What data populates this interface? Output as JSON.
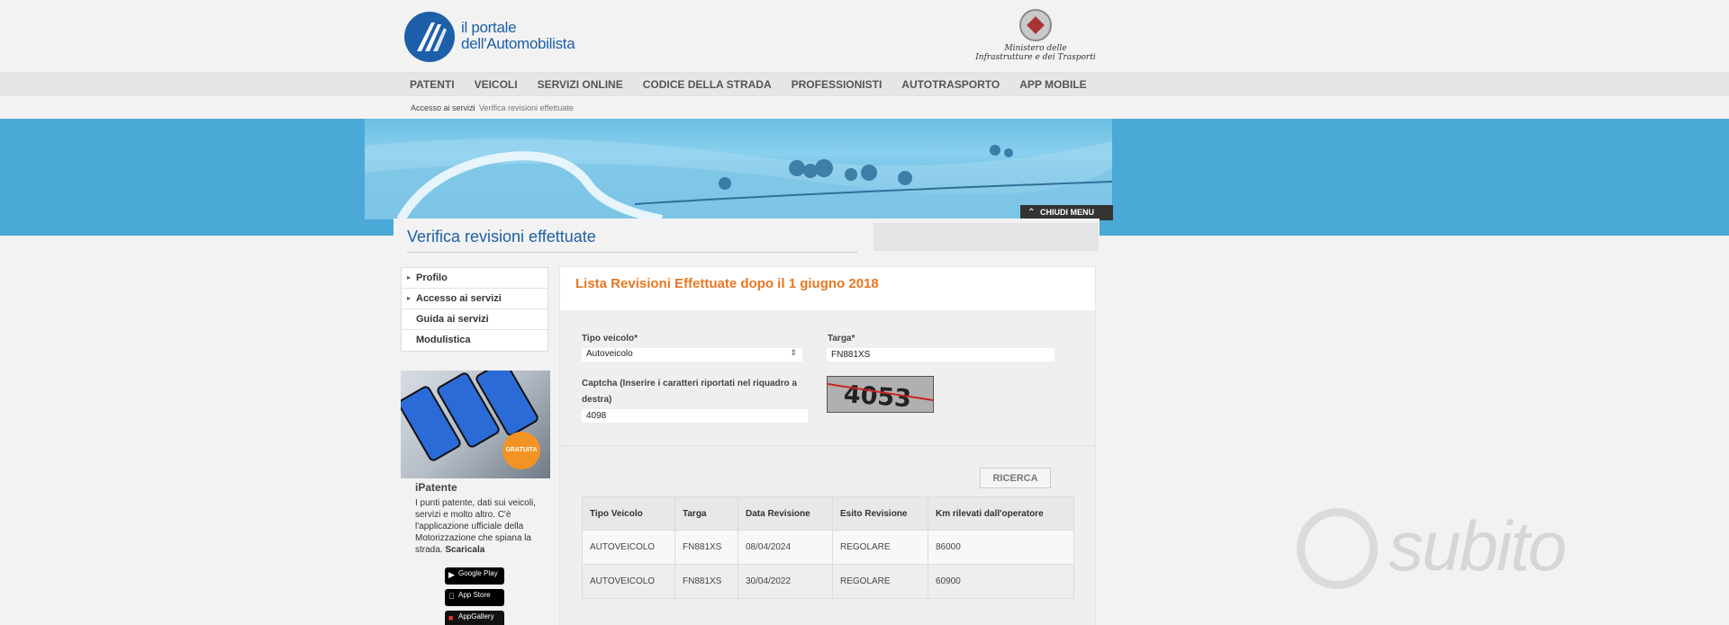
{
  "header": {
    "logo_line1": "il portale",
    "logo_line2": "dell'Automobilista",
    "ministry_line1": "Ministero delle",
    "ministry_line2": "Infrastrutture e dei Trasporti"
  },
  "nav": {
    "items": [
      "PATENTI",
      "VEICOLI",
      "SERVIZI ONLINE",
      "CODICE DELLA STRADA",
      "PROFESSIONISTI",
      "AUTOTRASPORTO",
      "APP MOBILE"
    ]
  },
  "breadcrumb": {
    "items": [
      "Accesso ai servizi",
      "Verifica revisioni effettuate"
    ],
    "separator": "//"
  },
  "banner": {
    "close_menu_label": "CHIUDI MENU"
  },
  "page_title": "Verifica revisioni effettuate",
  "sidebar": {
    "items": [
      {
        "label": "Profilo",
        "has_arrow": true
      },
      {
        "label": "Accesso ai servizi",
        "has_arrow": true
      },
      {
        "label": "Guida ai servizi",
        "has_arrow": false
      },
      {
        "label": "Modulistica",
        "has_arrow": false
      }
    ],
    "promo_badge": "GRATUITA",
    "promo_title": "iPatente",
    "promo_text": "I punti patente, dati sui veicoli, servizi e molto altro. C'è l'applicazione ufficiale della Motorizzazione che spiana la strada.",
    "promo_link": "Scaricala",
    "stores": [
      "Google Play",
      "App Store",
      "AppGallery"
    ]
  },
  "panel": {
    "title": "Lista Revisioni Effettuate dopo il 1 giugno 2018",
    "tipo_veicolo_label": "Tipo veicolo*",
    "tipo_veicolo_value": "Autoveicolo",
    "targa_label": "Targa*",
    "targa_value": "FN881XS",
    "captcha_label": "Captcha (Inserire i caratteri riportati nel riquadro a destra)",
    "captcha_value": "4098",
    "captcha_image_text": "4053",
    "search_button": "RICERCA"
  },
  "table": {
    "headers": [
      "Tipo Veicolo",
      "Targa",
      "Data Revisione",
      "Esito Revisione",
      "Km rilevati dall'operatore"
    ],
    "rows": [
      [
        "AUTOVEICOLO",
        "FN881XS",
        "08/04/2024",
        "REGOLARE",
        "86000"
      ],
      [
        "AUTOVEICOLO",
        "FN881XS",
        "30/04/2022",
        "REGOLARE",
        "60900"
      ]
    ]
  },
  "watermark": {
    "text": "subito"
  },
  "colors": {
    "brand_blue": "#1d5fa8",
    "accent_orange": "#e87722",
    "banner_blue": "#4aa9d6"
  }
}
